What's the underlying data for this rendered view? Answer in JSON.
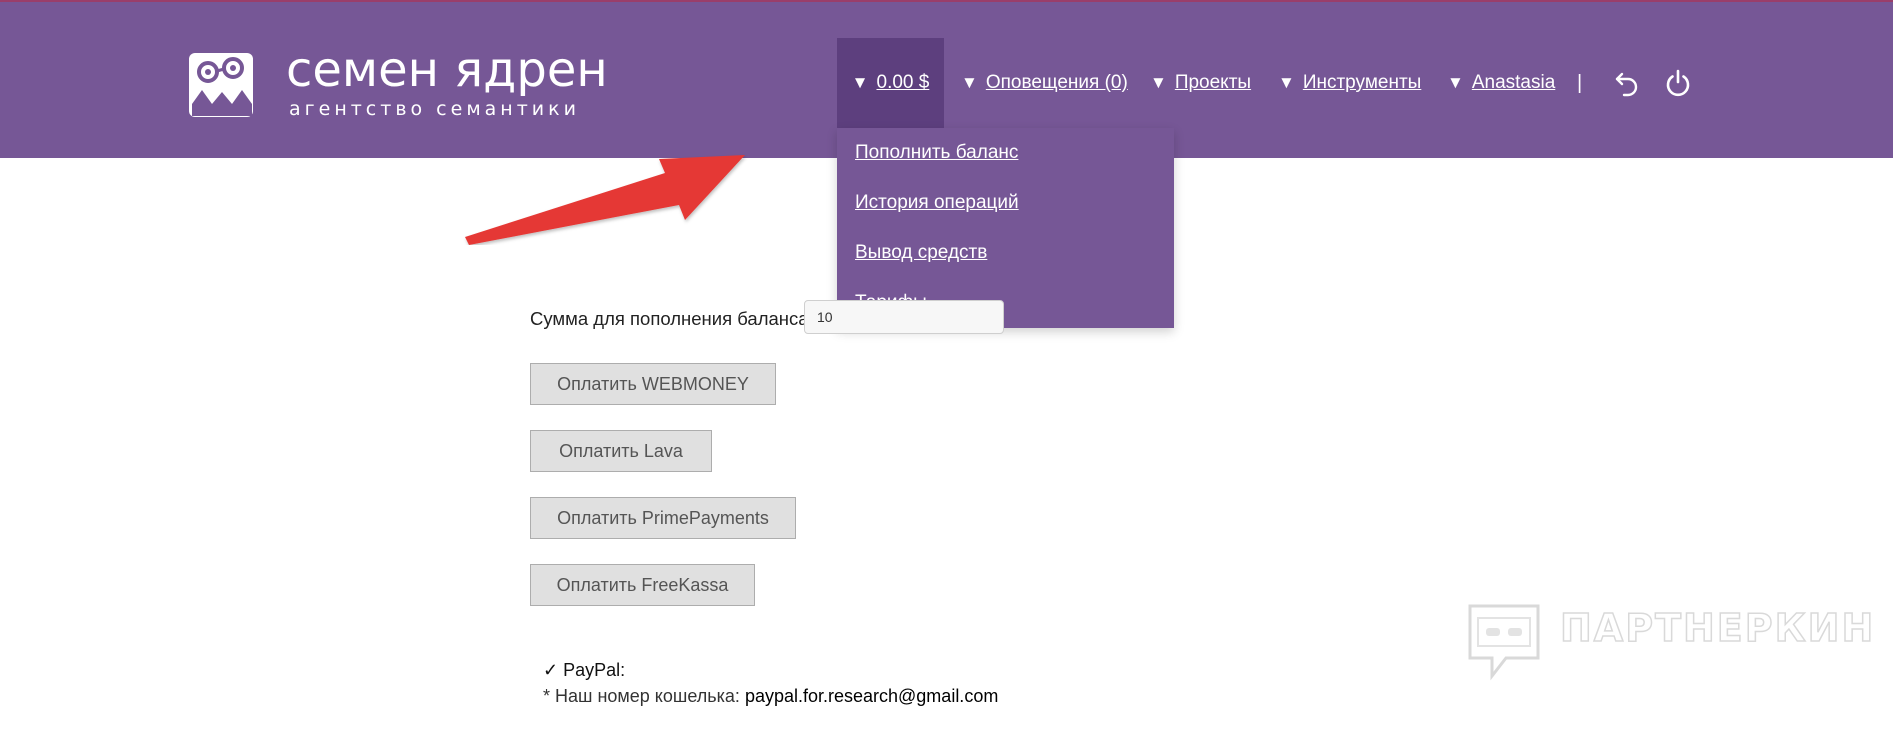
{
  "logo": {
    "title": "семен ядрен",
    "subtitle": "агентство семантики"
  },
  "nav": {
    "balance": "0.00 $",
    "notifications": "Оповещения (0)",
    "projects": "Проекты",
    "tools": "Инструменты",
    "user": "Anastasia",
    "separator": "|",
    "dropdown_marker": "▼"
  },
  "dropdown": {
    "items": [
      "Пополнить баланс",
      "История операций",
      "Вывод средств",
      "Тарифы"
    ]
  },
  "form": {
    "amount_label": "Сумма для пополнения баланса:",
    "amount_value": "10"
  },
  "buttons": {
    "webmoney": "Оплатить WEBMONEY",
    "lava": "Оплатить Lava",
    "primepayments": "Оплатить PrimePayments",
    "freekassa": "Оплатить FreeKassa"
  },
  "paypal": {
    "check": "✓",
    "label": "PayPal:",
    "wallet_label": "* Наш номер кошелька:",
    "wallet_value": "paypal.for.research@gmail.com"
  },
  "watermark": {
    "text": "ПАРТНЕРКИН"
  },
  "colors": {
    "header_bg": "#765796",
    "active_bg": "#5d3f7e",
    "arrow": "#e53935"
  },
  "icons": [
    "logo-icon",
    "undo-icon",
    "power-icon",
    "arrow-annotation",
    "watermark-icon"
  ]
}
